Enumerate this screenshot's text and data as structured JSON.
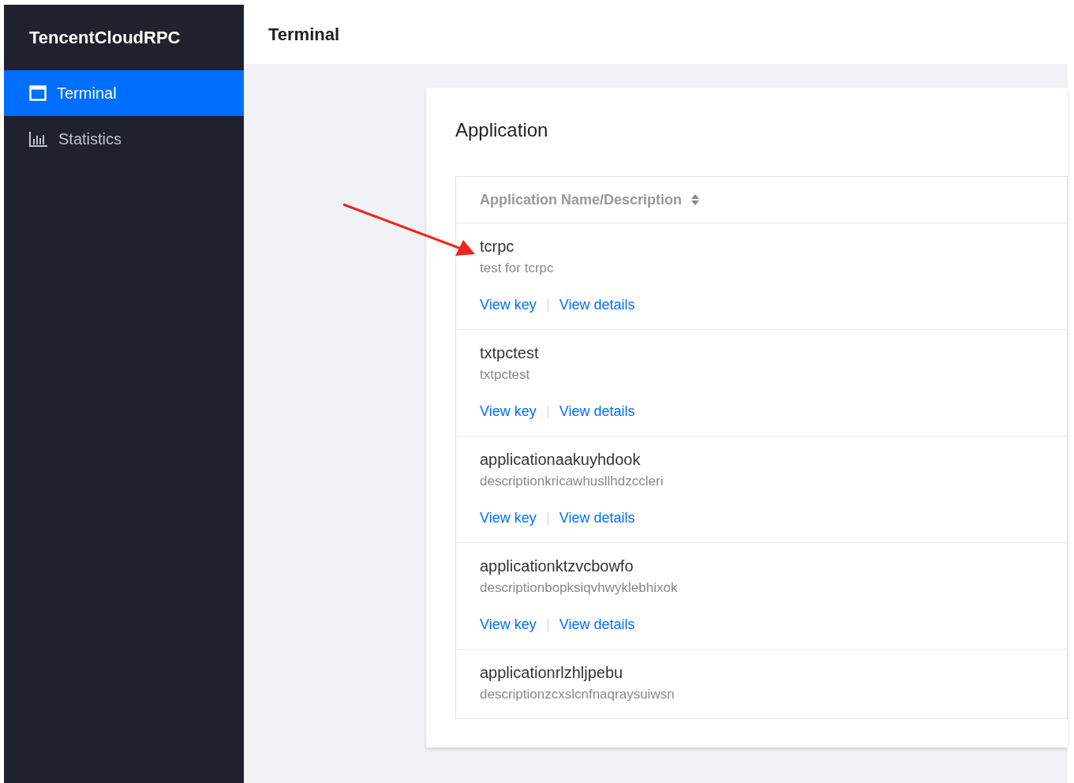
{
  "sidebar": {
    "logo": "TencentCloudRPC",
    "items": [
      {
        "label": "Terminal",
        "selected": true
      },
      {
        "label": "Statistics",
        "selected": false
      }
    ]
  },
  "header": {
    "title": "Terminal"
  },
  "card": {
    "title": "Application",
    "table": {
      "columns": [
        {
          "label": "Application Name/Description",
          "sortable": true
        }
      ],
      "rows": [
        {
          "name": "tcrpc",
          "description": "test for tcrpc",
          "links": [
            "View key",
            "View details"
          ]
        },
        {
          "name": "txtpctest",
          "description": "txtpctest",
          "links": [
            "View key",
            "View details"
          ]
        },
        {
          "name": "applicationaakuyhdook",
          "description": "descriptionkricawhusllhdzccleri",
          "links": [
            "View key",
            "View details"
          ]
        },
        {
          "name": "applicationktzvcbowfo",
          "description": "descriptionbopksiqvhwyklebhixok",
          "links": [
            "View key",
            "View details"
          ]
        },
        {
          "name": "applicationrlzhljpebu",
          "description": "descriptionzcxslcnfnaqraysuiwsn",
          "links": []
        }
      ]
    }
  }
}
